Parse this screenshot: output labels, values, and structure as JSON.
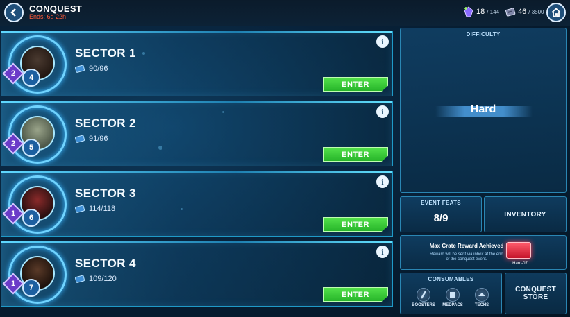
{
  "header": {
    "title": "CONQUEST",
    "subtitle": "Ends: 6d 22h"
  },
  "currency": {
    "energy_value": "18",
    "energy_max": "/ 144",
    "keycards_value": "46",
    "keycards_max": "/ 3500"
  },
  "sectors": [
    {
      "name": "SECTOR 1",
      "rank": "2",
      "level": "4",
      "progress": "90/96",
      "enter_label": "ENTER"
    },
    {
      "name": "SECTOR 2",
      "rank": "2",
      "level": "5",
      "progress": "91/96",
      "enter_label": "ENTER"
    },
    {
      "name": "SECTOR 3",
      "rank": "1",
      "level": "6",
      "progress": "114/118",
      "enter_label": "ENTER"
    },
    {
      "name": "SECTOR 4",
      "rank": "1",
      "level": "7",
      "progress": "109/120",
      "enter_label": "ENTER"
    }
  ],
  "info_label": "i",
  "difficulty": {
    "title": "DIFFICULTY",
    "value": "Hard"
  },
  "feats": {
    "title": "EVENT FEATS",
    "value": "8/9"
  },
  "inventory_label": "INVENTORY",
  "crate": {
    "title": "Max Crate Reward Achieved",
    "description": "Reward will be sent via inbox at the end of the conquest event.",
    "label": "Hard-07"
  },
  "consumables": {
    "title": "CONSUMABLES",
    "items": [
      {
        "label": "BOOSTERS",
        "icon": "booster-icon"
      },
      {
        "label": "MEDPACS",
        "icon": "medpac-icon"
      },
      {
        "label": "TECHS",
        "icon": "tech-icon"
      }
    ]
  },
  "store_label": "CONQUEST STORE",
  "colors": {
    "accent": "#1f9ac8",
    "enter_green": "#27b52a",
    "timer_red": "#ff5a3a",
    "rank_purple": "#6b3bc8"
  }
}
